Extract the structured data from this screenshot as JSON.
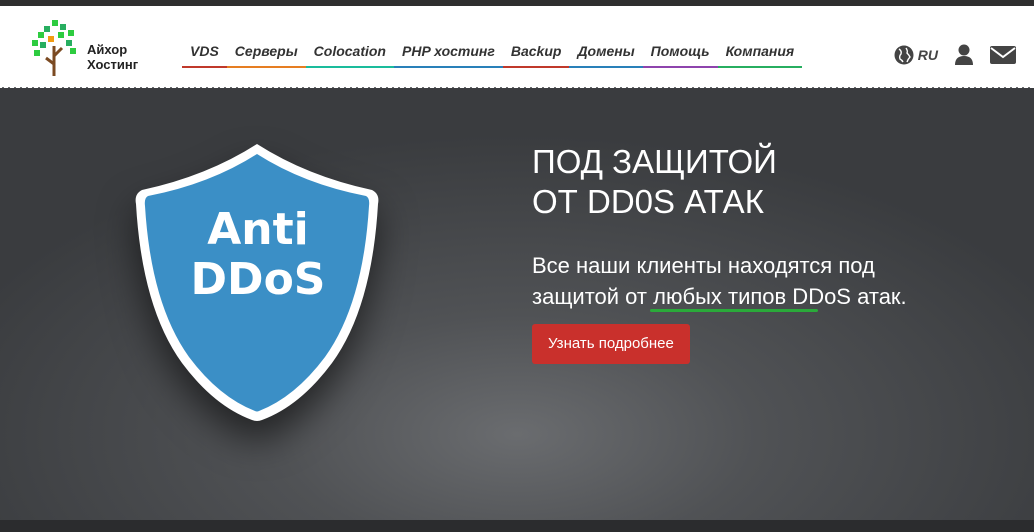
{
  "brand": {
    "line1": "Айхор",
    "line2": "Хостинг"
  },
  "nav": [
    {
      "label": "VDS",
      "color": "#c0392b"
    },
    {
      "label": "Серверы",
      "color": "#e67e22"
    },
    {
      "label": "Colocation",
      "color": "#1abc9c"
    },
    {
      "label": "PHP хостинг",
      "color": "#2980b9"
    },
    {
      "label": "Backup",
      "color": "#c0392b"
    },
    {
      "label": "Домены",
      "color": "#2980b9"
    },
    {
      "label": "Помощь",
      "color": "#8e44ad"
    },
    {
      "label": "Компания",
      "color": "#27ae60"
    }
  ],
  "header_right": {
    "language": "RU",
    "globe_icon": "globe-icon",
    "user_icon": "user-icon",
    "mail_icon": "envelope-icon"
  },
  "hero": {
    "badge_line1": "Anti",
    "badge_line2": "DDoS",
    "title_line1": "ПОД ЗАЩИТОЙ",
    "title_line2": "ОТ DD0S АТАК",
    "desc_part1": "Все наши клиенты находятся под",
    "desc_part2": "защитой от ",
    "desc_highlight": "любых типов DDoS",
    "desc_part3": " атак.",
    "button_label": "Узнать подробнее"
  },
  "colors": {
    "accent_button": "#c9302c",
    "shield": "#3b8fc6",
    "underline": "#2aaa3a"
  }
}
